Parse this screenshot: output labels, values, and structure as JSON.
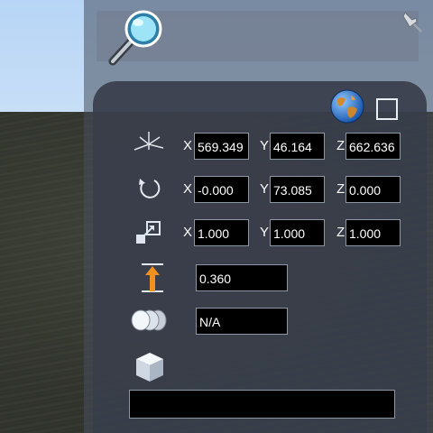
{
  "position": {
    "x_label": "X",
    "x_value": "569.349",
    "y_label": "Y",
    "y_value": "46.164",
    "z_label": "Z",
    "z_value": "662.636"
  },
  "rotation": {
    "x_label": "X",
    "x_value": "-0.000",
    "y_label": "Y",
    "y_value": "73.085",
    "z_label": "Z",
    "z_value": "0.000"
  },
  "scale": {
    "x_label": "X",
    "x_value": "1.000",
    "y_label": "Y",
    "y_value": "1.000",
    "z_label": "Z",
    "z_value": "1.000"
  },
  "height_offset": {
    "value": "0.360"
  },
  "lod": {
    "value": "N/A"
  },
  "object_name": {
    "value": ""
  },
  "icons": {
    "search": "search-icon",
    "pin": "pin-icon",
    "globe": "globe-icon",
    "position": "axis-gizmo-icon",
    "rotation": "rotate-icon",
    "scale": "scale-icon",
    "height": "height-arrow-icon",
    "lod": "lod-icon",
    "object": "cube-icon"
  },
  "colors": {
    "sky": "#b7d5f6",
    "panel": "#383e4a",
    "field_bg": "#000000",
    "accent_orange": "#f0901e"
  }
}
